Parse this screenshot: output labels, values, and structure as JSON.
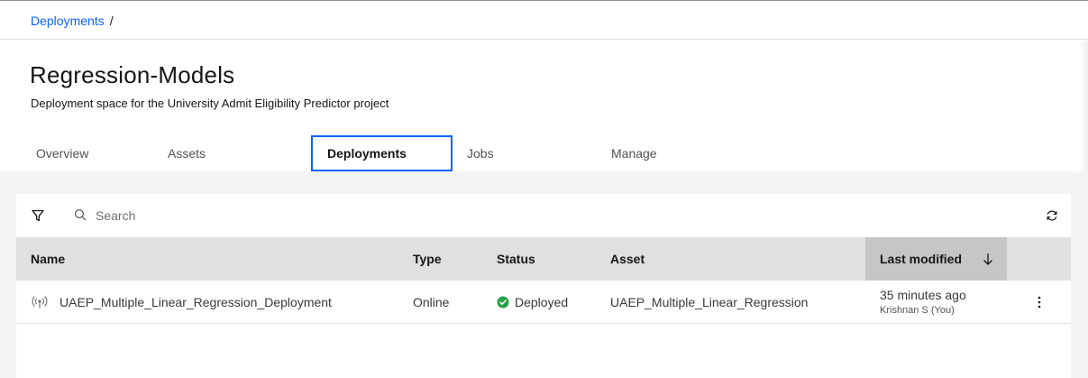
{
  "breadcrumb": {
    "items": [
      "Deployments"
    ],
    "separator": "/"
  },
  "header": {
    "title": "Regression-Models",
    "subtitle": "Deployment space for the University Admit Eligibility Predictor project"
  },
  "tabs": [
    {
      "label": "Overview"
    },
    {
      "label": "Assets"
    },
    {
      "label": "Deployments",
      "selected": true
    },
    {
      "label": "Jobs"
    },
    {
      "label": "Manage"
    }
  ],
  "toolbar": {
    "search_placeholder": "Search",
    "filter_icon": "filter-icon",
    "search_icon": "search-icon",
    "refresh_icon": "refresh-icon"
  },
  "table": {
    "columns": [
      "Name",
      "Type",
      "Status",
      "Asset",
      "Last modified"
    ],
    "sort_column": "Last modified",
    "sort_direction": "descending",
    "rows": [
      {
        "name": "UAEP_Multiple_Linear_Regression_Deployment",
        "type": "Online",
        "status": "Deployed",
        "asset": "UAEP_Multiple_Linear_Regression",
        "modified_time": "35 minutes ago",
        "modified_by": "Krishnan S (You)"
      }
    ]
  },
  "colors": {
    "accent": "#0f62fe",
    "deployed": "#24a148",
    "header_bg": "#e0e0e0",
    "sorted_header_bg": "#c6c6c6",
    "content_bg": "#f4f4f4"
  }
}
